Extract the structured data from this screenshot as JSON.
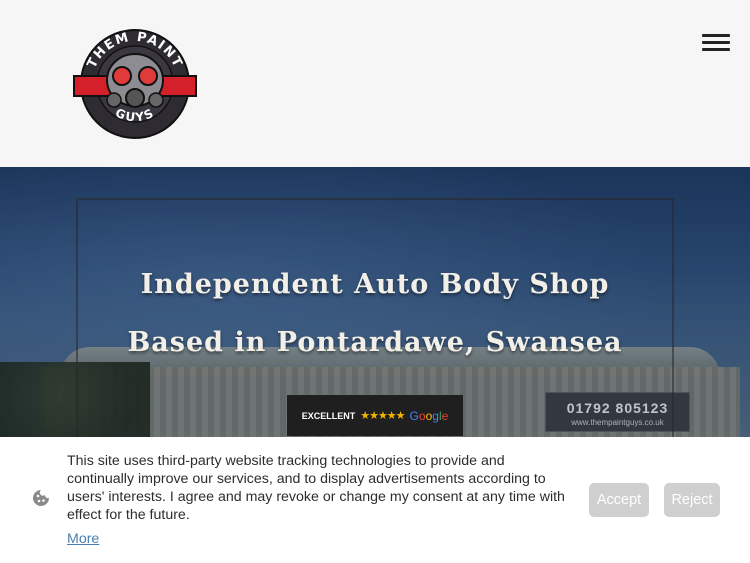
{
  "brand": {
    "logo_text_top": "THEM PAINT",
    "logo_text_bottom": "GUYS"
  },
  "header": {
    "menu_icon": "hamburger-menu-icon"
  },
  "hero": {
    "line1": "Independent Auto Body Shop",
    "line2": "Based in Pontardawe, Swansea",
    "sign_phone": "01792 805123",
    "sign_web": "www.thempaintguys.co.uk"
  },
  "review_badge": {
    "label": "EXCELLENT",
    "stars": "★★★★★",
    "provider_letters": [
      "G",
      "o",
      "o",
      "g",
      "l",
      "e"
    ],
    "provider_colors": [
      "#4285F4",
      "#EA4335",
      "#FBBC05",
      "#4285F4",
      "#34A853",
      "#EA4335"
    ]
  },
  "cookie_banner": {
    "icon": "cookie-icon",
    "text": "This site uses third-party website tracking technologies to provide and continually improve our services, and to display advertisements according to users' interests. I agree and may revoke or change my consent at any time with effect for the future.",
    "more_link": "More",
    "accept_label": "Accept",
    "reject_label": "Reject"
  },
  "colors": {
    "logo_red": "#d3202b",
    "logo_dark": "#2e2b33",
    "link": "#4a7fb2",
    "button_bg": "#cfcfcf"
  }
}
